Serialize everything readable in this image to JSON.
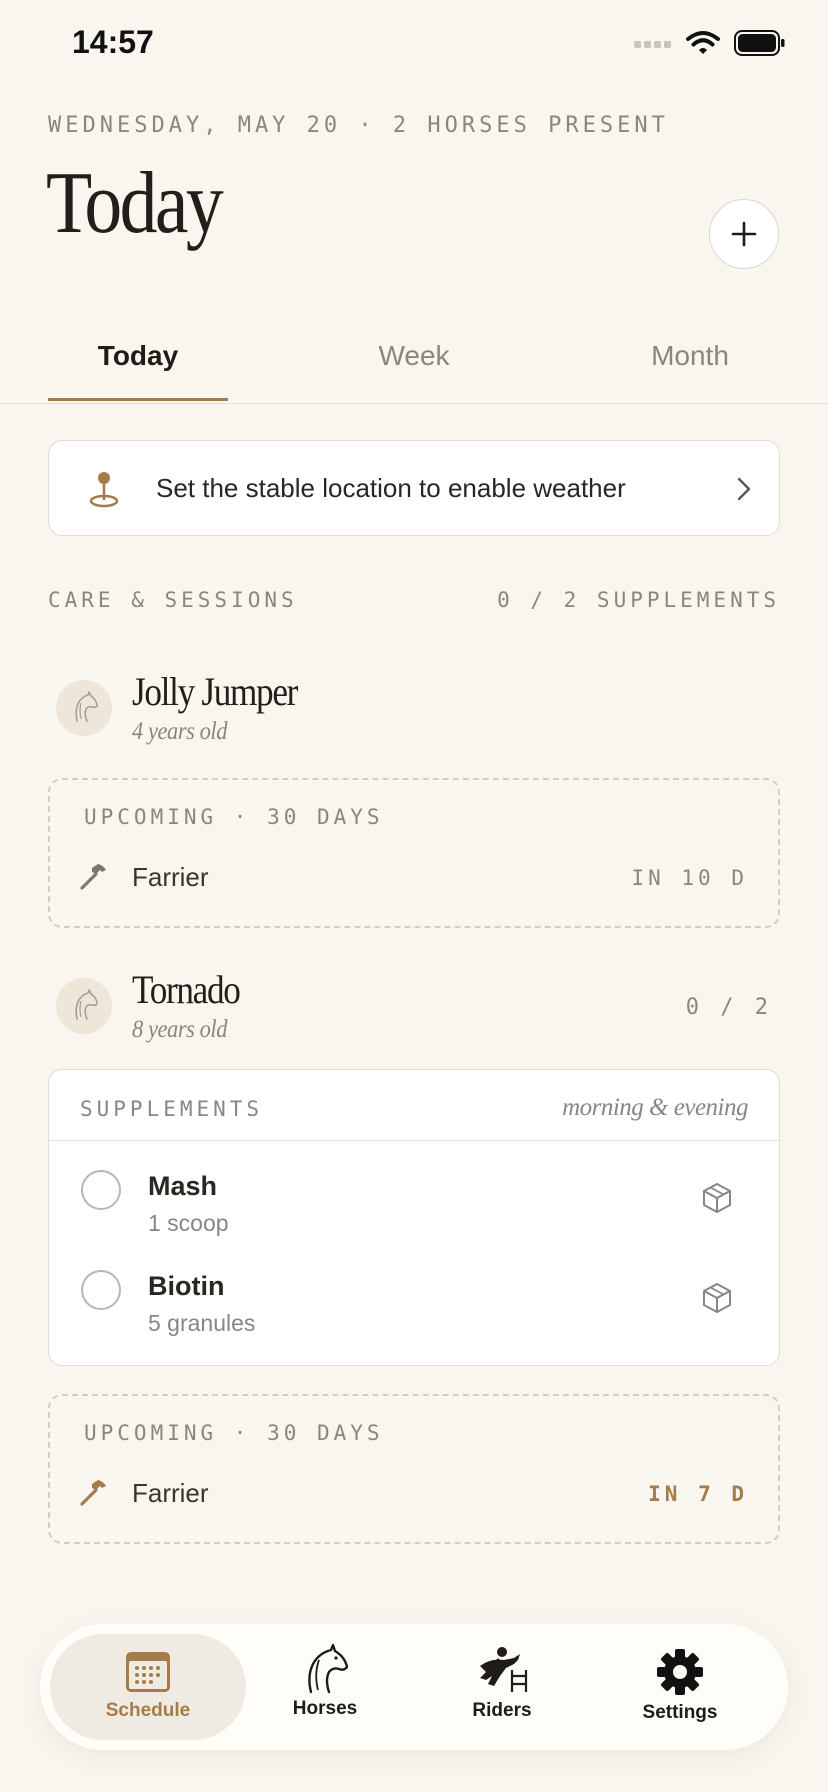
{
  "status_bar": {
    "time": "14:57"
  },
  "header": {
    "date_line": "WEDNESDAY, MAY 20 · 2 HORSES PRESENT",
    "title": "Today",
    "add_icon": "plus-icon"
  },
  "tabs": [
    {
      "label": "Today",
      "active": true
    },
    {
      "label": "Week",
      "active": false
    },
    {
      "label": "Month",
      "active": false
    }
  ],
  "location_prompt": {
    "text": "Set the stable location to enable weather",
    "icon": "map-pin-icon"
  },
  "section": {
    "title": "CARE & SESSIONS",
    "summary": "0 / 2 SUPPLEMENTS"
  },
  "horses": [
    {
      "name": "Jolly Jumper",
      "age": "4 years old",
      "upcoming": {
        "title": "UPCOMING · 30 DAYS",
        "item": "Farrier",
        "due": "IN 10 D"
      }
    },
    {
      "name": "Tornado",
      "age": "8 years old",
      "count": "0 / 2",
      "supplements": {
        "title": "SUPPLEMENTS",
        "time": "morning & evening",
        "items": [
          {
            "name": "Mash",
            "dose": "1 scoop"
          },
          {
            "name": "Biotin",
            "dose": "5 granules"
          }
        ]
      },
      "upcoming": {
        "title": "UPCOMING · 30 DAYS",
        "item": "Farrier",
        "due": "IN 7 D"
      }
    }
  ],
  "nav": [
    {
      "label": "Schedule",
      "icon": "calendar-icon",
      "active": true
    },
    {
      "label": "Horses",
      "icon": "horse-head-icon",
      "active": false
    },
    {
      "label": "Riders",
      "icon": "rider-jumping-icon",
      "active": false
    },
    {
      "label": "Settings",
      "icon": "gear-icon",
      "active": false
    }
  ],
  "colors": {
    "background": "#f9f6f0",
    "accent": "#a57b4a",
    "muted": "#8a8580",
    "card": "#ffffff"
  }
}
